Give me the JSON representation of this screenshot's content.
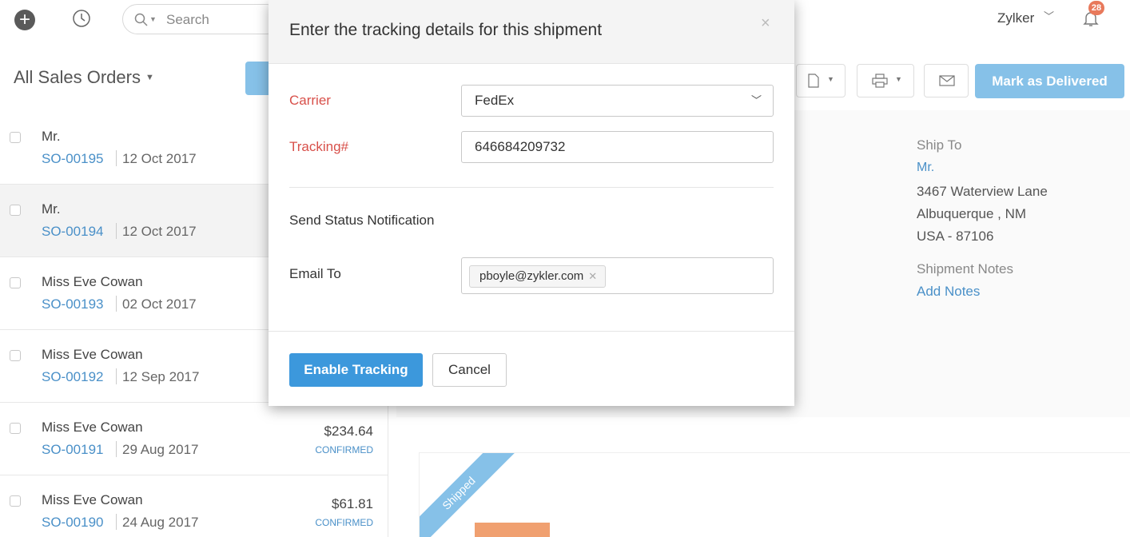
{
  "topbar": {
    "search_placeholder": "Search",
    "org_name": "Zylker",
    "notification_count": "28"
  },
  "list": {
    "title": "All Sales Orders",
    "rows": [
      {
        "name": "Mr.",
        "number": "SO-00195",
        "date": "12 Oct 2017",
        "amount": "",
        "status": ""
      },
      {
        "name": "Mr.",
        "number": "SO-00194",
        "date": "12 Oct 2017",
        "amount": "",
        "status": ""
      },
      {
        "name": "Miss Eve Cowan",
        "number": "SO-00193",
        "date": "02 Oct 2017",
        "amount": "",
        "status": ""
      },
      {
        "name": "Miss Eve Cowan",
        "number": "SO-00192",
        "date": "12 Sep 2017",
        "amount": "",
        "status": ""
      },
      {
        "name": "Miss Eve Cowan",
        "number": "SO-00191",
        "date": "29 Aug 2017",
        "amount": "$234.64",
        "status": "CONFIRMED"
      },
      {
        "name": "Miss Eve Cowan",
        "number": "SO-00190",
        "date": "24 Aug 2017",
        "amount": "$61.81",
        "status": "CONFIRMED"
      }
    ]
  },
  "toolbar": {
    "mark_delivered_label": "Mark as Delivered"
  },
  "detail": {
    "ship_to_label": "Ship To",
    "ship_to_name": "Mr.",
    "address_line1": "3467 Waterview Lane",
    "address_line2": "Albuquerque , NM",
    "address_line3": "USA - 87106",
    "shipment_notes_label": "Shipment Notes",
    "add_notes_label": "Add Notes",
    "ribbon_label": "Shipped"
  },
  "modal": {
    "title": "Enter the tracking details for this shipment",
    "close_glyph": "×",
    "carrier_label": "Carrier",
    "carrier_value": "FedEx",
    "tracking_label": "Tracking#",
    "tracking_value": "646684209732",
    "notification_label": "Send Status Notification",
    "email_label": "Email To",
    "email_chip": "pboyle@zykler.com",
    "enable_label": "Enable Tracking",
    "cancel_label": "Cancel"
  }
}
